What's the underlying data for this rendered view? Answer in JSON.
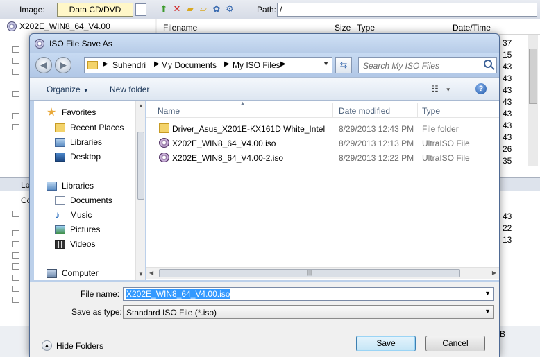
{
  "background": {
    "image_label": "Image:",
    "image_type": "Data CD/DVD",
    "path_label": "Path:",
    "path_value": "/",
    "tree_root": "X202E_WIN8_64_V4.00",
    "columns": {
      "filename": "Filename",
      "size": "Size",
      "type": "Type",
      "datetime": "Date/Time"
    },
    "right_numbers": [
      "37",
      "15",
      "43",
      "43",
      "43",
      "43",
      "43",
      "43",
      "43",
      "26",
      "35"
    ],
    "lower_header": "Lo",
    "lower_tree_first": "Co",
    "lower_right_numbers": [
      "43",
      "22",
      "13"
    ],
    "status_tail": "B"
  },
  "dialog": {
    "title": "ISO File Save As",
    "breadcrumb": [
      "Suhendri",
      "My Documents",
      "My ISO Files"
    ],
    "search_placeholder": "Search My ISO Files",
    "organize_label": "Organize",
    "new_folder_label": "New folder",
    "nav": {
      "favorites": "Favorites",
      "recent_places": "Recent Places",
      "libraries_fav": "Libraries",
      "desktop": "Desktop",
      "libraries": "Libraries",
      "documents": "Documents",
      "music": "Music",
      "pictures": "Pictures",
      "videos": "Videos",
      "computer": "Computer"
    },
    "columns": {
      "name": "Name",
      "date": "Date modified",
      "type": "Type"
    },
    "files": [
      {
        "name": "Driver_Asus_X201E-KX161D White_Intel",
        "date": "8/29/2013 12:43 PM",
        "type": "File folder",
        "icon": "folder-icon"
      },
      {
        "name": "X202E_WIN8_64_V4.00.iso",
        "date": "8/29/2013 12:13 PM",
        "type": "UltraISO File",
        "icon": "iso-icon"
      },
      {
        "name": "X202E_WIN8_64_V4.00-2.iso",
        "date": "8/29/2013 12:22 PM",
        "type": "UltraISO File",
        "icon": "iso-icon"
      }
    ],
    "file_name_label": "File name:",
    "file_name_value": "X202E_WIN8_64_V4.00.iso",
    "save_type_label": "Save as type:",
    "save_type_value": "Standard ISO File (*.iso)",
    "hide_folders_label": "Hide Folders",
    "save_label": "Save",
    "cancel_label": "Cancel"
  }
}
